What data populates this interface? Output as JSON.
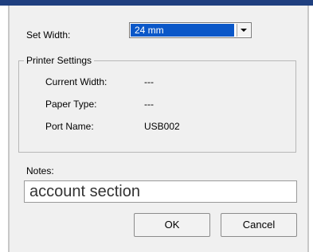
{
  "set_width": {
    "label": "Set Width:",
    "value": "24 mm"
  },
  "printer_settings": {
    "title": "Printer Settings",
    "rows": [
      {
        "label": "Current Width:",
        "value": "---"
      },
      {
        "label": "Paper Type:",
        "value": "---"
      },
      {
        "label": "Port Name:",
        "value": "USB002"
      }
    ]
  },
  "notes": {
    "label": "Notes:",
    "value": "account section"
  },
  "buttons": {
    "ok": "OK",
    "cancel": "Cancel"
  },
  "colors": {
    "title_bar": "#1f3f7f",
    "selection": "#0a57c8",
    "dialog_bg": "#f0f0f0"
  }
}
